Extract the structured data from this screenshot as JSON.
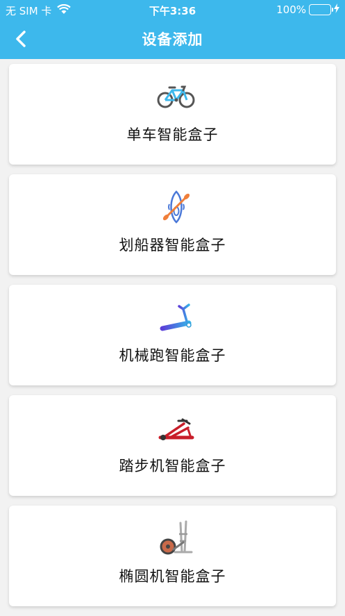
{
  "status_bar": {
    "carrier": "无 SIM 卡",
    "time": "下午3:36",
    "battery": "100%"
  },
  "nav": {
    "title": "设备添加",
    "back_icon": "chevron-left-icon"
  },
  "colors": {
    "header": "#3db8ec",
    "battery_fill": "#4cd964",
    "card_bg": "#ffffff",
    "page_bg": "#f2f2f2"
  },
  "devices": [
    {
      "label": "单车智能盒子",
      "icon": "bicycle-icon"
    },
    {
      "label": "划船器智能盒子",
      "icon": "kayak-icon"
    },
    {
      "label": "机械跑智能盒子",
      "icon": "treadmill-icon"
    },
    {
      "label": "踏步机智能盒子",
      "icon": "stepper-icon"
    },
    {
      "label": "椭圆机智能盒子",
      "icon": "elliptical-icon"
    }
  ]
}
